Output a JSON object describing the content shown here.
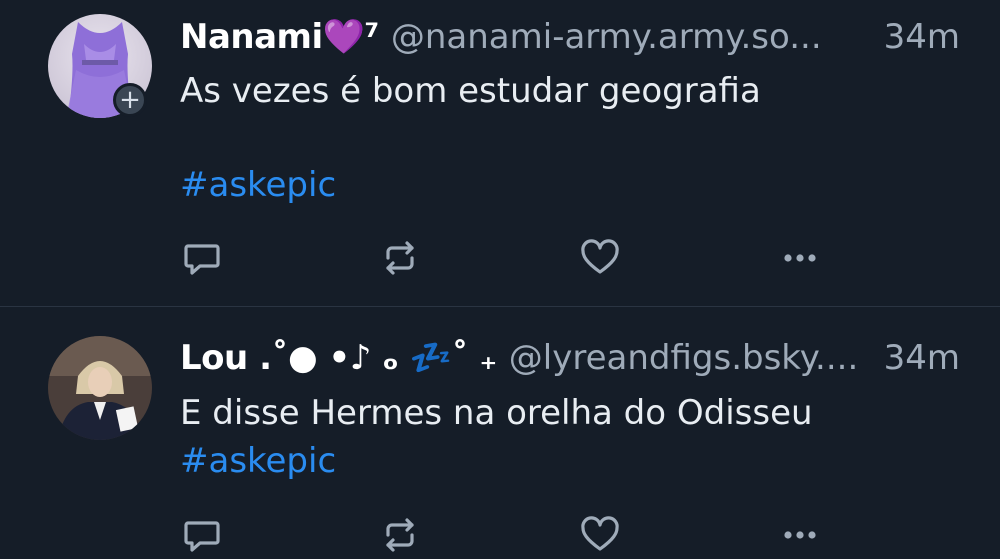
{
  "colors": {
    "background": "#151d28",
    "text": "#e8edf2",
    "muted": "#9fabb9",
    "hashtag": "#2a8cf0",
    "divider": "#2a3442"
  },
  "posts": [
    {
      "author": {
        "display_name": "Nanami💜⁷",
        "handle": "@nanami-army.army.so...",
        "avatar_icon": "avatar-purple-gown",
        "follow_badge": "+"
      },
      "time": "34m",
      "text": "As vezes é bom estudar geografia",
      "hashtag": "#askepic",
      "actions": [
        "reply-icon",
        "repost-icon",
        "like-icon",
        "more-icon"
      ]
    },
    {
      "author": {
        "display_name": "Lou .˚● •♪ ₒ 💤˚ ₊",
        "handle": "@lyreandfigs.bsky....",
        "avatar_icon": "avatar-person-suit"
      },
      "time": "34m",
      "text": "E disse Hermes na orelha do Odisseu",
      "hashtag": "#askepic",
      "actions": [
        "reply-icon",
        "repost-icon",
        "like-icon",
        "more-icon"
      ]
    }
  ]
}
